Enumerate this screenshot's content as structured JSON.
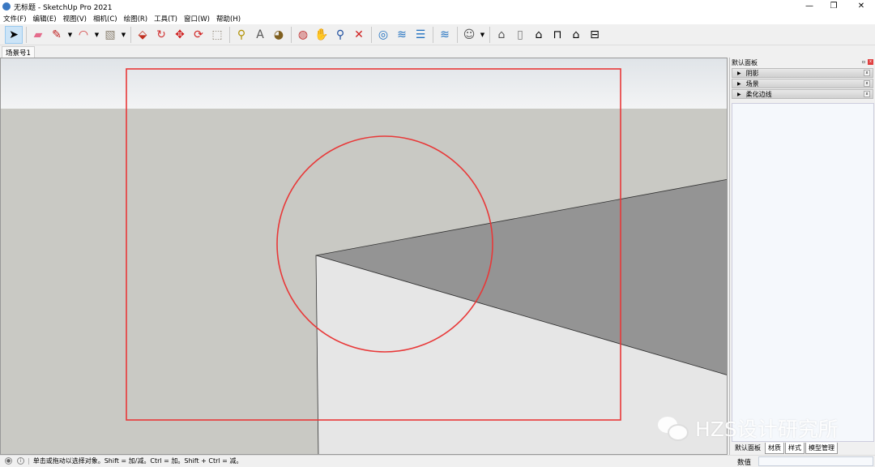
{
  "window": {
    "title": "无标题 - SketchUp Pro 2021",
    "controls": [
      "—",
      "❐",
      "✕"
    ]
  },
  "menu": [
    "文件(F)",
    "编辑(E)",
    "视图(V)",
    "相机(C)",
    "绘图(R)",
    "工具(T)",
    "窗口(W)",
    "帮助(H)"
  ],
  "toolbar": [
    {
      "name": "select-icon",
      "glyph": "➤",
      "sel": true
    },
    {
      "sep": true
    },
    {
      "name": "eraser-icon",
      "glyph": "▰",
      "color": "#e46c8c"
    },
    {
      "name": "pencil-icon",
      "glyph": "✎",
      "color": "#c02020"
    },
    {
      "dd": true
    },
    {
      "name": "arc-icon",
      "glyph": "◠",
      "color": "#d03030"
    },
    {
      "dd": true
    },
    {
      "name": "rectangle-icon",
      "glyph": "▧",
      "color": "#8a8070"
    },
    {
      "dd": true
    },
    {
      "sep": true
    },
    {
      "name": "push-pull-icon",
      "glyph": "⬙",
      "color": "#c03020"
    },
    {
      "name": "follow-me-icon",
      "glyph": "↻",
      "color": "#d03030"
    },
    {
      "name": "move-icon",
      "glyph": "✥",
      "color": "#d02020"
    },
    {
      "name": "rotate-icon",
      "glyph": "⟳",
      "color": "#d02020"
    },
    {
      "name": "scale-icon",
      "glyph": "⬚",
      "color": "#8a8070"
    },
    {
      "sep": true
    },
    {
      "name": "tape-measure-icon",
      "glyph": "⚲",
      "color": "#b09000"
    },
    {
      "name": "text-icon",
      "glyph": "A",
      "color": "#555"
    },
    {
      "name": "paint-bucket-icon",
      "glyph": "◕",
      "color": "#806020"
    },
    {
      "sep": true
    },
    {
      "name": "orbit-icon",
      "glyph": "◍",
      "color": "#c03030"
    },
    {
      "name": "pan-icon",
      "glyph": "✋",
      "color": "#c8a860"
    },
    {
      "name": "zoom-icon",
      "glyph": "⚲",
      "color": "#2050a0"
    },
    {
      "name": "zoom-extents-icon",
      "glyph": "✕",
      "color": "#d02020"
    },
    {
      "sep": true
    },
    {
      "name": "warehouse-icon",
      "glyph": "◎",
      "color": "#2070c0"
    },
    {
      "name": "extension-icon",
      "glyph": "≋",
      "color": "#2070c0"
    },
    {
      "name": "layers-out-icon",
      "glyph": "☰",
      "color": "#2070c0"
    },
    {
      "sep": true
    },
    {
      "name": "extension-manager-icon",
      "glyph": "≋",
      "color": "#2070c0"
    },
    {
      "sep": true
    },
    {
      "name": "account-icon",
      "glyph": "☺",
      "color": "#555"
    },
    {
      "dd": true
    },
    {
      "sep": true
    },
    {
      "name": "iso-view-icon",
      "glyph": "⌂",
      "color": "#555"
    },
    {
      "name": "top-view-icon",
      "glyph": "▯",
      "color": "#777"
    },
    {
      "name": "front-view-icon",
      "glyph": "⌂",
      "color": "#000"
    },
    {
      "name": "right-view-icon",
      "glyph": "⊓",
      "color": "#000"
    },
    {
      "name": "back-view-icon",
      "glyph": "⌂",
      "color": "#000"
    },
    {
      "name": "left-view-icon",
      "glyph": "⊟",
      "color": "#000"
    }
  ],
  "scene_tab": "场景号1",
  "panel": {
    "title": "默认面板",
    "pin": "▫",
    "close": "x",
    "trays": [
      "阴影",
      "场景",
      "柔化边线"
    ],
    "tray_close": "x",
    "tabs": [
      "默认面板",
      "材质",
      "样式",
      "模型管理"
    ]
  },
  "status": {
    "message": "单击或拖动以选择对象。Shift = 加/减。Ctrl = 加。Shift + Ctrl = 减。",
    "vcb_label": "数值",
    "vcb_value": ""
  },
  "watermark": "HZS设计研究所",
  "colors": {
    "sky_top": "#e2e6ea",
    "sky_bottom": "#f2f3f4",
    "ground": "#c9c9c4",
    "top_face": "#949494",
    "front_face": "#e6e6e6",
    "annotation": "#e83838"
  }
}
